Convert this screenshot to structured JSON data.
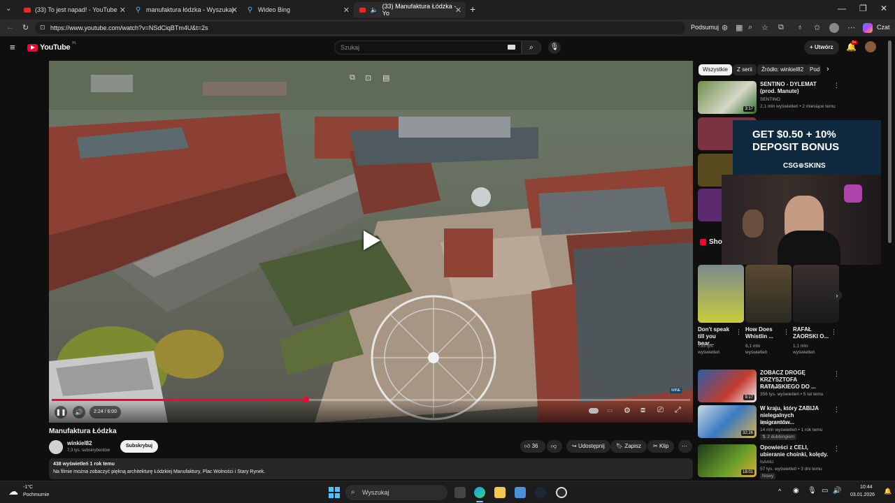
{
  "browser": {
    "tabs": [
      {
        "label": "(33) To jest napad! - YouTube",
        "favicon": "youtube-icon"
      },
      {
        "label": "manufaktura łódzka - Wyszukaj",
        "favicon": "bing-search-icon"
      },
      {
        "label": "Wideo Bing",
        "favicon": "bing-search-icon"
      },
      {
        "label": "(33) Manufaktura Łódzka - Yo",
        "favicon": "youtube-icon"
      }
    ],
    "url": "https://www.youtube.com/watch?v=NSdCiqBTm4U&t=2s",
    "summarize_label": "Podsumuj",
    "copilot_label": "Czat"
  },
  "youtube": {
    "logo_text": "YouTube",
    "logo_region": "PL",
    "search_placeholder": "Szukaj",
    "create_label": "Utwórz",
    "notif_count": "9+"
  },
  "video": {
    "time": "2:24 / 6:00",
    "progress": 0.4,
    "title": "Manufaktura Łódzka",
    "channel": "winkiel82",
    "subscribers": "7,3 tys. subskrybentów",
    "subscribe_label": "Subskrybuj",
    "likes": "36",
    "share_label": "Udostępnij",
    "save_label": "Zapisz",
    "clip_label": "Klip",
    "views_line": "438 wyświetleń  1 rok temu",
    "description": "Na filmie można zobaczyć piękną architekturę Łódzkiej Manufaktury, Plac Wolności i Stary Rynek."
  },
  "chips": [
    "Wszystkie",
    "Z serii",
    "Źródło: winkiel82",
    "Pod"
  ],
  "sidebar": {
    "videos": [
      {
        "title": "SENTINO - DYLEMAT (prod. Manute)",
        "channel": "SENTINO",
        "meta": "2,1 mln wyświetleń • 2 miesiące temu",
        "duration": "3:17"
      },
      {
        "title": "ZOBACZ DROGĘ KRZYSZTOFA RATAJSKIEGO DO ...",
        "channel": "TVP Sport",
        "meta": "356 tys. wyświetleń • 5 lat temu",
        "duration": "9:17"
      },
      {
        "title": "W kraju, który ZABIJA nielegalnych imigrantów...",
        "channel": "Tyler Oliveira",
        "meta": "14 mln wyświetleń • 1 rok temu",
        "extra": "2 dubbingiem",
        "duration": "32:26"
      },
      {
        "title": "Opowieści z CELI, ubieranie choinki, kolędy.",
        "channel": "IsAmU",
        "meta": "57 tys. wyświetleń • 3 dni temu",
        "extra": "Nowy",
        "duration": "18:01"
      }
    ],
    "shorts_label": "Sho",
    "shorts": [
      {
        "title": "Don't speak till you hear...",
        "views": "733 tys. wyświetleń"
      },
      {
        "title": "How Does Whistlin ...",
        "views": "6,1 mln wyświetleń"
      },
      {
        "title": "RAFAŁ ZAORSKI O...",
        "views": "1,1 mln wyświetleń"
      }
    ],
    "ad": {
      "line1": "GET $0.50 + 10%",
      "line2": "DEPOSIT BONUS",
      "brand": "CSG⊕SKINS"
    }
  },
  "taskbar": {
    "weather_temp": "-1°C",
    "weather_desc": "Pochmurnie",
    "search_placeholder": "Wyszukaj",
    "time": "10:44",
    "date": "03.01.2026"
  },
  "colors": {
    "accent": "#ff0033",
    "bg": "#0f0f0f"
  }
}
